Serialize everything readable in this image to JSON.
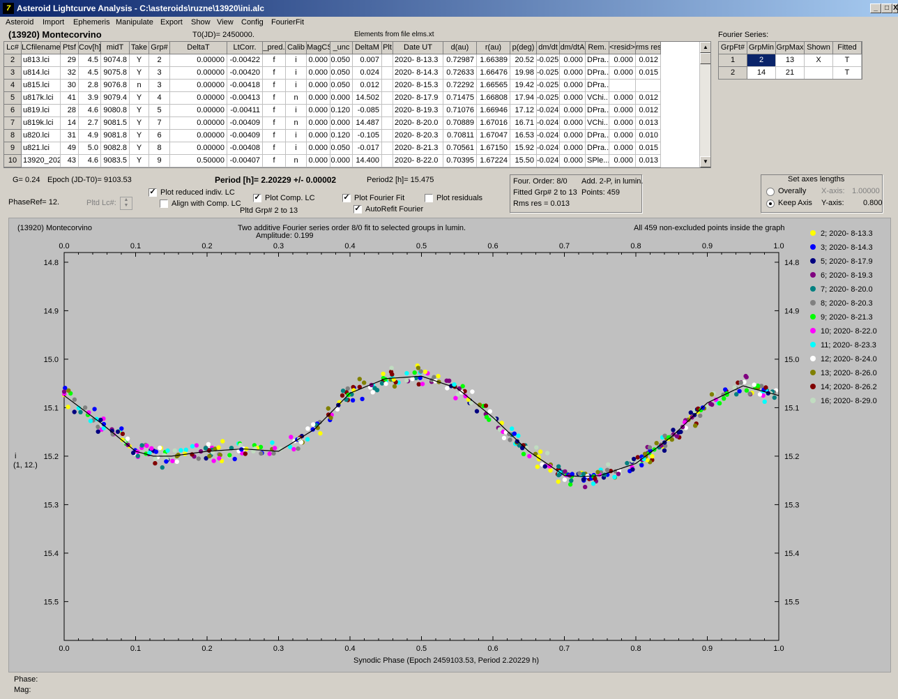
{
  "window": {
    "title": "Asteroid Lightcurve Analysis - C:\\asteroids\\ruzne\\13920\\ini.alc",
    "minimize": "_",
    "maximize": "□",
    "close": "X",
    "icon": "app-icon"
  },
  "menu": [
    "Asteroid",
    "Import",
    "Ephemeris",
    "Manipulate",
    "Export",
    "Show",
    "View",
    "Config",
    "FourierFit"
  ],
  "header": {
    "asteroid": "(13920) Montecorvino",
    "t0": "T0(JD)= 2450000.",
    "elements": "Elements from file elms.xt"
  },
  "table": {
    "columns": [
      "Lc#",
      "LCfilename",
      "Ptsf",
      "Cov[h]",
      "midT",
      "Take",
      "Grp#",
      "DeltaT",
      "LtCorr.",
      "_pred.",
      "Calib",
      "MagCS",
      "_unc",
      "DeltaM",
      "Plt",
      "Date UT",
      "d(au)",
      "r(au)",
      "p(deg)",
      "dm/dt",
      "dm/dtA",
      "Rem.",
      "<resid>",
      "rms res"
    ],
    "rows": [
      [
        "2",
        "u813.lci",
        "29",
        "4.5",
        "9074.8",
        "Y",
        "2",
        "0.00000",
        "-0.00422",
        "f",
        "i",
        "0.000",
        "0.050",
        "0.007",
        "",
        "2020- 8-13.3",
        "0.72987",
        "1.66389",
        "20.52",
        "-0.025",
        "0.000",
        "DPra...",
        "0.000",
        "0.012"
      ],
      [
        "3",
        "u814.lci",
        "32",
        "4.5",
        "9075.8",
        "Y",
        "3",
        "0.00000",
        "-0.00420",
        "f",
        "i",
        "0.000",
        "0.050",
        "0.024",
        "",
        "2020- 8-14.3",
        "0.72633",
        "1.66476",
        "19.98",
        "-0.025",
        "0.000",
        "DPra...",
        "0.000",
        "0.015"
      ],
      [
        "4",
        "u815.lci",
        "30",
        "2.8",
        "9076.8",
        "n",
        "3",
        "0.00000",
        "-0.00418",
        "f",
        "i",
        "0.000",
        "0.050",
        "0.012",
        "",
        "2020- 8-15.3",
        "0.72292",
        "1.66565",
        "19.42",
        "-0.025",
        "0.000",
        "DPra...",
        "",
        ""
      ],
      [
        "5",
        "u817k.lci",
        "41",
        "3.9",
        "9079.4",
        "Y",
        "4",
        "0.00000",
        "-0.00413",
        "f",
        "n",
        "0.000",
        "0.000",
        "14.502",
        "",
        "2020- 8-17.9",
        "0.71475",
        "1.66808",
        "17.94",
        "-0.025",
        "0.000",
        "VChi...",
        "0.000",
        "0.012"
      ],
      [
        "6",
        "u819.lci",
        "28",
        "4.6",
        "9080.8",
        "Y",
        "5",
        "0.00000",
        "-0.00411",
        "f",
        "i",
        "0.000",
        "0.120",
        "-0.085",
        "",
        "2020- 8-19.3",
        "0.71076",
        "1.66946",
        "17.12",
        "-0.024",
        "0.000",
        "DPra...",
        "0.000",
        "0.012"
      ],
      [
        "7",
        "u819k.lci",
        "14",
        "2.7",
        "9081.5",
        "Y",
        "7",
        "0.00000",
        "-0.00409",
        "f",
        "n",
        "0.000",
        "0.000",
        "14.487",
        "",
        "2020- 8-20.0",
        "0.70889",
        "1.67016",
        "16.71",
        "-0.024",
        "0.000",
        "VChi...",
        "0.000",
        "0.013"
      ],
      [
        "8",
        "u820.lci",
        "31",
        "4.9",
        "9081.8",
        "Y",
        "6",
        "0.00000",
        "-0.00409",
        "f",
        "i",
        "0.000",
        "0.120",
        "-0.105",
        "",
        "2020- 8-20.3",
        "0.70811",
        "1.67047",
        "16.53",
        "-0.024",
        "0.000",
        "DPra...",
        "0.000",
        "0.010"
      ],
      [
        "9",
        "u821.lci",
        "49",
        "5.0",
        "9082.8",
        "Y",
        "8",
        "0.00000",
        "-0.00408",
        "f",
        "i",
        "0.000",
        "0.050",
        "-0.017",
        "",
        "2020- 8-21.3",
        "0.70561",
        "1.67150",
        "15.92",
        "-0.024",
        "0.000",
        "DPra...",
        "0.000",
        "0.015"
      ],
      [
        "10",
        "13920_2020082",
        "43",
        "4.6",
        "9083.5",
        "Y",
        "9",
        "0.50000",
        "-0.00407",
        "f",
        "n",
        "0.000",
        "0.000",
        "14.400",
        "",
        "2020- 8-22.0",
        "0.70395",
        "1.67224",
        "15.50",
        "-0.024",
        "0.000",
        "SPle...",
        "0.000",
        "0.013"
      ]
    ]
  },
  "fourier": {
    "title": "Fourier Series:",
    "columns": [
      "GrpFt#",
      "GrpMin",
      "GrpMax",
      "Shown",
      "Fitted"
    ],
    "rows": [
      [
        "1",
        "2",
        "13",
        "X",
        "T"
      ],
      [
        "2",
        "14",
        "21",
        "",
        "T"
      ]
    ]
  },
  "controls": {
    "g": "G= 0.24",
    "epoch": "Epoch (JD-T0)= 9103.53",
    "period": "Period [h]= 2.20229 +/- 0.00002",
    "period2": "Period2 [h]= 15.475",
    "phaseref": "PhaseRef= 12.",
    "pltd_lc": "Pltd Lc#:",
    "plot_reduced": "Plot reduced indiv. LC",
    "align_comp": "Align with Comp. LC",
    "plot_comp": "Plot Comp. LC",
    "pltd_grp": "Pltd Grp#  2  to  13",
    "plot_fourier": "Plot Fourier Fit",
    "autorefit": "AutoRefit Fourier",
    "plot_resid": "Plot residuals",
    "plot_reduced_checked": true,
    "align_comp_checked": false,
    "plot_comp_checked": true,
    "plot_fourier_checked": true,
    "autorefit_checked": true,
    "plot_resid_checked": false,
    "fit_info": [
      "Four. Order:  8/0",
      "Add. 2-P, in lumin.",
      "Fitted Grp# 2 to 13",
      "Points: 459",
      "Rms res     = 0.013"
    ],
    "axes": {
      "title": "Set axes lengths",
      "overally": "Overally",
      "keep": "Keep Axis",
      "xaxis_label": "X-axis:",
      "xaxis_val": "1.00000",
      "yaxis_label": "Y-axis:",
      "yaxis_val": "0.800",
      "selected": "Keep Axis"
    }
  },
  "chart_data": {
    "type": "scatter",
    "title": "(13920) Montecorvino",
    "subtitle": "Two additive Fourier series order 8/0 fit to selected groups in lumin.",
    "amplitude": "Amplitude: 0.199",
    "note": "All 459 non-excluded points inside the graph",
    "xlabel": "Synodic Phase (Epoch 2459103.53, Period 2.20229 h)",
    "ylabel": [
      "i",
      "(1, 12.)"
    ],
    "xlim": [
      0,
      1
    ],
    "ylim": [
      15.58,
      14.78
    ],
    "xticks": [
      "0.0",
      "0.1",
      "0.2",
      "0.3",
      "0.4",
      "0.5",
      "0.6",
      "0.7",
      "0.8",
      "0.9",
      "1.0"
    ],
    "yticks": [
      "14.8",
      "14.9",
      "15.0",
      "15.1",
      "15.2",
      "15.3",
      "15.4",
      "15.5"
    ],
    "fit_curve": {
      "x": [
        0,
        0.05,
        0.1,
        0.125,
        0.15,
        0.2,
        0.25,
        0.3,
        0.35,
        0.4,
        0.45,
        0.5,
        0.55,
        0.6,
        0.65,
        0.7,
        0.725,
        0.75,
        0.8,
        0.85,
        0.9,
        0.95,
        1.0
      ],
      "y": [
        15.075,
        15.13,
        15.19,
        15.2,
        15.2,
        15.19,
        15.185,
        15.19,
        15.145,
        15.07,
        15.04,
        15.035,
        15.06,
        15.12,
        15.19,
        15.24,
        15.242,
        15.24,
        15.215,
        15.16,
        15.09,
        15.055,
        15.075
      ]
    },
    "series": [
      {
        "name": "2; 2020- 8-13.3",
        "color": "#ffff00"
      },
      {
        "name": "3; 2020- 8-14.3",
        "color": "#0000ff"
      },
      {
        "name": "5; 2020- 8-17.9",
        "color": "#000080"
      },
      {
        "name": "6; 2020- 8-19.3",
        "color": "#800080"
      },
      {
        "name": "7; 2020- 8-20.0",
        "color": "#008080"
      },
      {
        "name": "8; 2020- 8-20.3",
        "color": "#808080"
      },
      {
        "name": "9; 2020- 8-21.3",
        "color": "#00ff00"
      },
      {
        "name": "10; 2020- 8-22.0",
        "color": "#ff00ff"
      },
      {
        "name": "11; 2020- 8-23.3",
        "color": "#00ffff"
      },
      {
        "name": "12; 2020- 8-24.0",
        "color": "#ffffff"
      },
      {
        "name": "13; 2020- 8-26.0",
        "color": "#808000"
      },
      {
        "name": "14; 2020- 8-26.2",
        "color": "#800000"
      },
      {
        "name": "16; 2020- 8-29.0",
        "color": "#c0dcc0"
      }
    ]
  },
  "status": {
    "phase": "Phase:",
    "mag": "Mag:"
  }
}
